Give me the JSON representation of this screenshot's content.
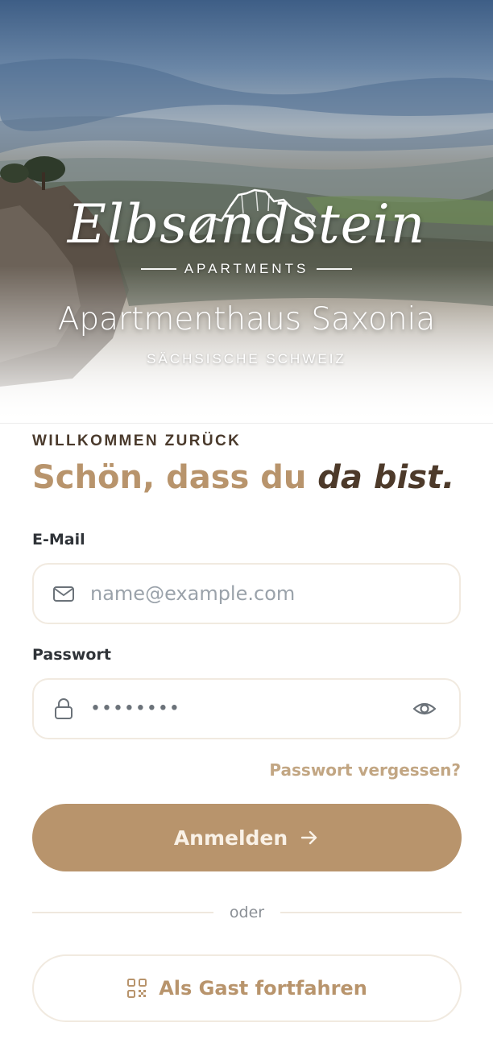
{
  "hero": {
    "logo_word": "Elbsandstein",
    "logo_sub": "APARTMENTS",
    "title": "Apartmenthaus Saxonia",
    "subtitle": "SÄCHSISCHE SCHWEIZ"
  },
  "welcome": {
    "eyebrow": "WILLKOMMEN ZURÜCK",
    "headline_plain": "Schön, dass du",
    "headline_emphasis": "da bist."
  },
  "form": {
    "email_label": "E-Mail",
    "email_placeholder": "name@example.com",
    "email_icon": "mail-icon",
    "password_label": "Passwort",
    "password_value": "••••••••",
    "password_icon": "lock-icon",
    "password_toggle_icon": "eye-icon",
    "forgot_link": "Passwort vergessen?",
    "submit_label": "Anmelden",
    "submit_icon": "arrow-right-icon"
  },
  "divider": {
    "text": "oder"
  },
  "guest": {
    "label": "Als Gast fortfahren",
    "icon": "qr-code-icon"
  },
  "colors": {
    "accent": "#b8946c",
    "accent_dark": "#4d3a2a",
    "field_border": "#f1eae0",
    "muted_text": "#9aa2aa"
  }
}
